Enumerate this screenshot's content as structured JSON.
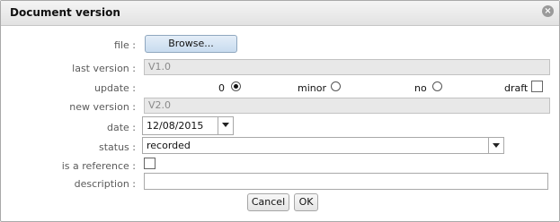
{
  "dialog": {
    "title": "Document version"
  },
  "labels": {
    "file": "file :",
    "last_version": "last version :",
    "update": "update :",
    "new_version": "new version :",
    "date": "date :",
    "status": "status :",
    "is_reference": "is a reference :",
    "description": "description :"
  },
  "fields": {
    "browse_label": "Browse...",
    "last_version": "V1.0",
    "new_version": "V2.0",
    "date": "12/08/2015",
    "status": "recorded",
    "description": ""
  },
  "update_options": [
    {
      "label": "0",
      "selected": true
    },
    {
      "label": "minor",
      "selected": false
    },
    {
      "label": "no",
      "selected": false
    },
    {
      "label": "draft",
      "checked": false
    }
  ],
  "is_reference": false,
  "buttons": {
    "cancel": "Cancel",
    "ok": "OK"
  }
}
